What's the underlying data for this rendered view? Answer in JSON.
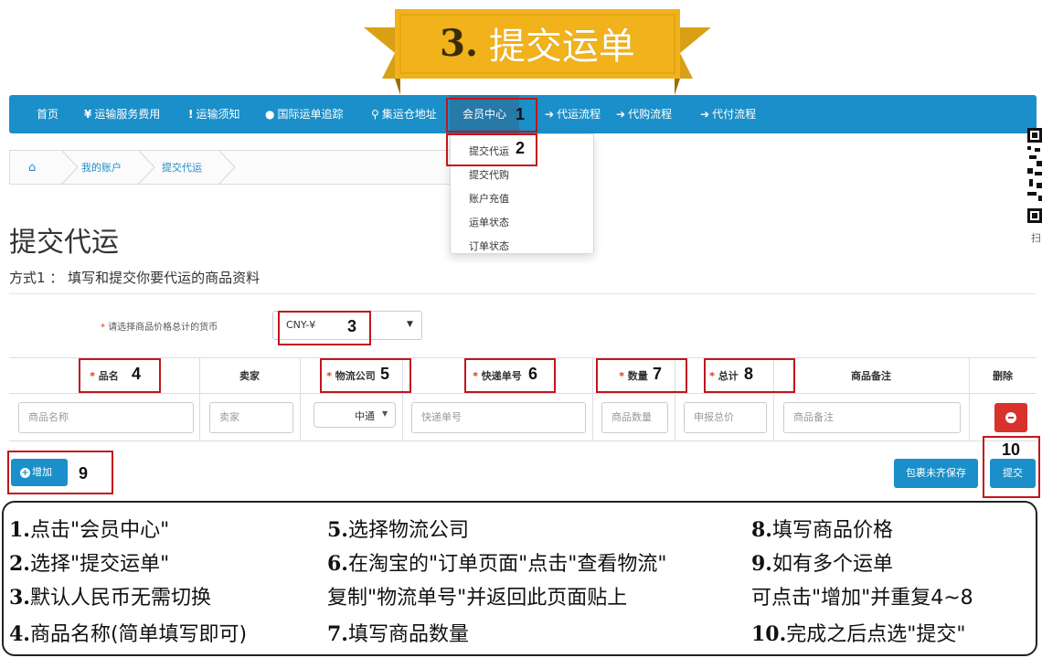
{
  "banner": {
    "number": "3.",
    "text": "提交运单",
    "color": "#f2b21b"
  },
  "navbar": {
    "items": [
      {
        "icon": "",
        "label": "首页"
      },
      {
        "icon": "¥",
        "label": "运输服务费用"
      },
      {
        "icon": "!",
        "label": "运输须知"
      },
      {
        "icon": "globe-icon",
        "label": "国际运单追踪"
      },
      {
        "icon": "map-marker-icon",
        "label": "集运仓地址"
      },
      {
        "icon": "",
        "label": "会员中心"
      },
      {
        "icon": "circle-arrow-icon",
        "label": "代运流程"
      },
      {
        "icon": "circle-arrow-icon",
        "label": "代购流程"
      },
      {
        "icon": "circle-arrow-icon",
        "label": "代付流程"
      }
    ],
    "color": "#1b8fc9"
  },
  "dropdown": {
    "items": [
      "提交代运",
      "提交代购",
      "账户充值",
      "运单状态",
      "订单状态"
    ]
  },
  "breadcrumb": {
    "items": [
      "我的账户",
      "提交代运"
    ]
  },
  "qr": {
    "label": "扫"
  },
  "page": {
    "title": "提交代运",
    "subtitle": "方式1 ： 填写和提交你要代运的商品资料"
  },
  "currency": {
    "label": "请选择商品价格总计的货币",
    "value": "CNY-¥"
  },
  "table": {
    "headers": [
      "品名",
      "卖家",
      "物流公司",
      "快递单号",
      "数量",
      "总计",
      "商品备注",
      "删除"
    ],
    "placeholders": {
      "name": "商品名称",
      "seller": "卖家",
      "courier": "中通",
      "tracking": "快递单号",
      "qty": "商品数量",
      "total": "申报总价",
      "note": "商品备注"
    }
  },
  "buttons": {
    "add": "增加",
    "save": "包裹未齐保存",
    "submit": "提交"
  },
  "markers": [
    "1",
    "2",
    "3",
    "4",
    "5",
    "6",
    "7",
    "8",
    "9",
    "10"
  ],
  "legend": {
    "col1": [
      {
        "n": "1.",
        "t": "点击\"会员中心\""
      },
      {
        "n": "2.",
        "t": "选择\"提交运单\""
      },
      {
        "n": "3.",
        "t": "默认人民币无需切换"
      },
      {
        "n": "4.",
        "t": "商品名称(简单填写即可)"
      }
    ],
    "col2": [
      {
        "n": "5.",
        "t": "选择物流公司"
      },
      {
        "n": "6.",
        "t": "在淘宝的\"订单页面\"点击\"查看物流\""
      },
      {
        "n": "",
        "t": "复制\"物流单号\"并返回此页面贴上"
      },
      {
        "n": "7.",
        "t": "填写商品数量"
      }
    ],
    "col3": [
      {
        "n": "8.",
        "t": "填写商品价格"
      },
      {
        "n": "9.",
        "t": "如有多个运单"
      },
      {
        "n": "",
        "t": "可点击\"增加\"并重复4~8"
      },
      {
        "n": "10.",
        "t": "完成之后点选\"提交\""
      }
    ]
  }
}
